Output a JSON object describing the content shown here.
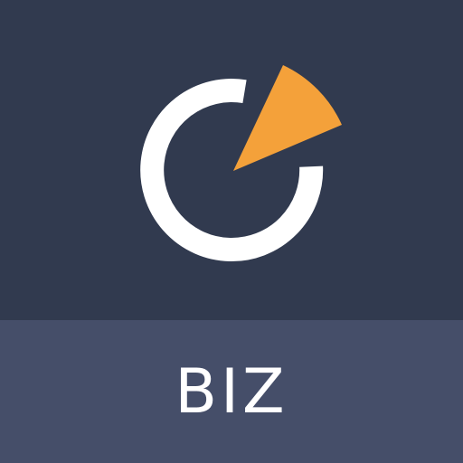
{
  "icon": {
    "label": "BIZ",
    "logo_icon": "ring-with-orange-slice-icon",
    "colors": {
      "top_background": "#313a4f",
      "bottom_background": "#454e69",
      "ring": "#ffffff",
      "slice": "#f4a13a",
      "label_text": "#ffffff"
    }
  }
}
